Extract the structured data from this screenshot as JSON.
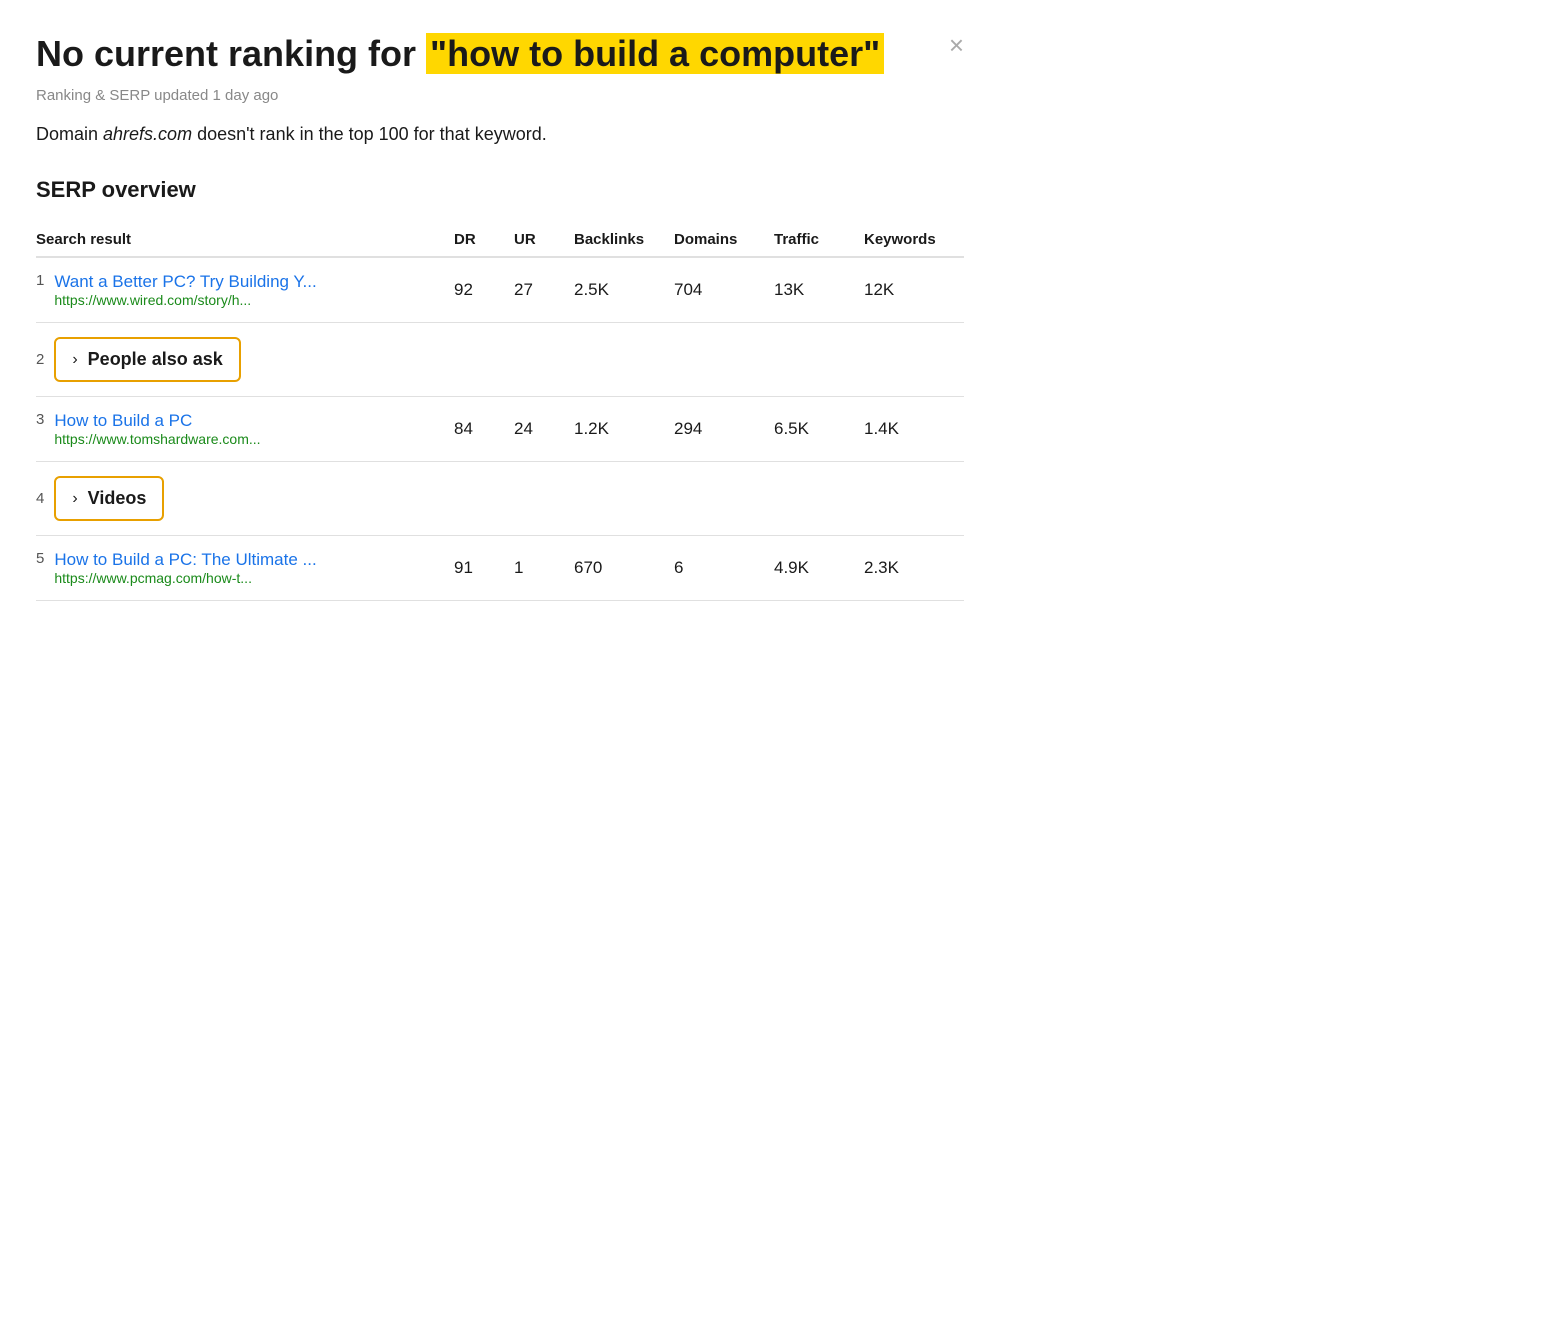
{
  "header": {
    "title_prefix": "No current ranking for ",
    "title_highlight": "\"how to build a computer\"",
    "close_label": "×",
    "subtitle": "Ranking & SERP updated 1 day ago",
    "domain_text_prefix": "Domain ",
    "domain_italic": "ahrefs.com",
    "domain_text_suffix": " doesn't rank in the top 100 for that keyword."
  },
  "serp": {
    "section_title": "SERP overview",
    "columns": {
      "search_result": "Search result",
      "dr": "DR",
      "ur": "UR",
      "backlinks": "Backlinks",
      "domains": "Domains",
      "traffic": "Traffic",
      "keywords": "Keywords"
    },
    "rows": [
      {
        "index": "1",
        "type": "normal",
        "title": "Want a Better PC? Try Building Y...",
        "url": "https://www.wired.com/story/h...",
        "dr": "92",
        "ur": "27",
        "backlinks": "2.5K",
        "domains": "704",
        "traffic": "13K",
        "keywords": "12K"
      },
      {
        "index": "2",
        "type": "special",
        "label": "People also ask"
      },
      {
        "index": "3",
        "type": "normal",
        "title": "How to Build a PC",
        "url": "https://www.tomshardware.com...",
        "dr": "84",
        "ur": "24",
        "backlinks": "1.2K",
        "domains": "294",
        "traffic": "6.5K",
        "keywords": "1.4K"
      },
      {
        "index": "4",
        "type": "special",
        "label": "Videos"
      },
      {
        "index": "5",
        "type": "normal",
        "title": "How to Build a PC: The Ultimate ...",
        "url": "https://www.pcmag.com/how-t...",
        "dr": "91",
        "ur": "1",
        "backlinks": "670",
        "domains": "6",
        "traffic": "4.9K",
        "keywords": "2.3K"
      }
    ]
  }
}
